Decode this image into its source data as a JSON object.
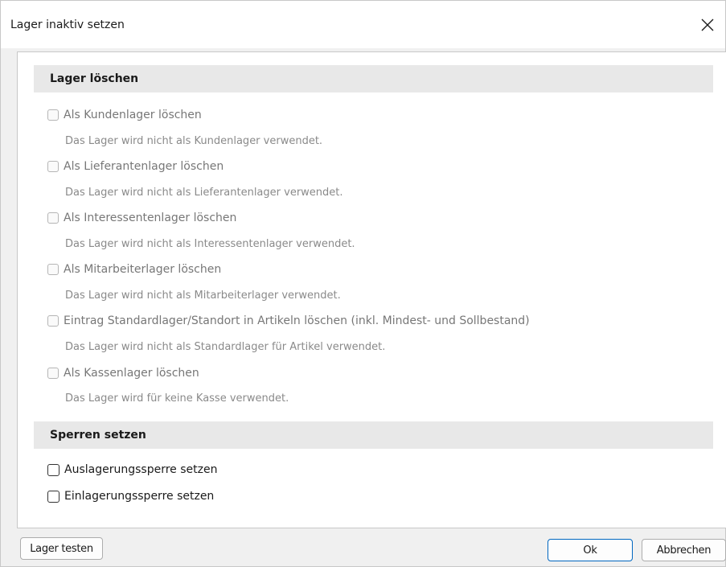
{
  "window": {
    "title": "Lager inaktiv setzen"
  },
  "sections": {
    "delete": {
      "header": "Lager löschen",
      "items": [
        {
          "label": "Als Kundenlager löschen",
          "desc": "Das Lager wird nicht als Kundenlager verwendet."
        },
        {
          "label": "Als Lieferantenlager löschen",
          "desc": "Das Lager wird nicht als Lieferantenlager verwendet."
        },
        {
          "label": "Als Interessentenlager löschen",
          "desc": "Das Lager wird nicht als Interessentenlager verwendet."
        },
        {
          "label": "Als Mitarbeiterlager löschen",
          "desc": "Das Lager wird nicht als Mitarbeiterlager verwendet."
        },
        {
          "label": "Eintrag Standardlager/Standort in Artikeln löschen (inkl. Mindest- und Sollbestand)",
          "desc": "Das Lager wird nicht als Standardlager für Artikel verwendet."
        },
        {
          "label": "Als Kassenlager löschen",
          "desc": "Das Lager wird für keine Kasse verwendet."
        }
      ]
    },
    "locks": {
      "header": "Sperren setzen",
      "items": [
        {
          "label": "Auslagerungssperre setzen"
        },
        {
          "label": "Einlagerungssperre setzen"
        }
      ]
    }
  },
  "buttons": {
    "test": "Lager testen",
    "ok": "Ok",
    "cancel": "Abbrechen"
  },
  "colors": {
    "accent": "#0067c0",
    "section_bg": "#e8e8e8"
  },
  "icons": {
    "close": "close-icon"
  }
}
